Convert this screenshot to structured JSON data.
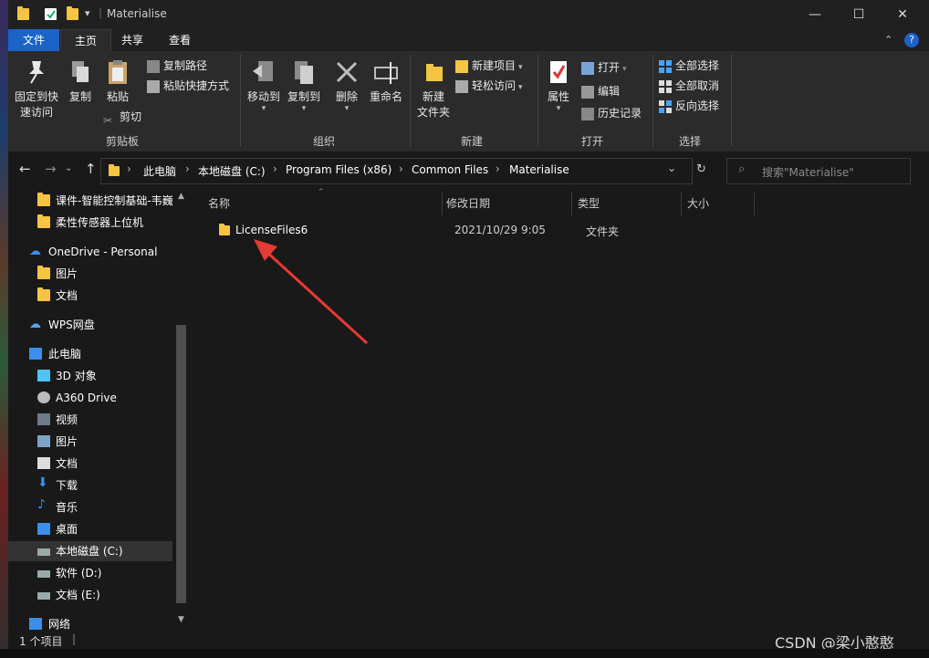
{
  "window": {
    "title": "Materialise",
    "minimize": "—",
    "maximize": "☐",
    "close": "✕"
  },
  "ribbon_tabs": [
    "文件",
    "主页",
    "共享",
    "查看"
  ],
  "ribbon": {
    "clipboard": {
      "pin_label_1": "固定到快",
      "pin_label_2": "速访问",
      "copy": "复制",
      "paste": "粘贴",
      "copy_path": "复制路径",
      "paste_shortcut": "粘贴快捷方式",
      "cut": "剪切",
      "group": "剪贴板"
    },
    "organize": {
      "move_to": "移动到",
      "copy_to": "复制到",
      "delete": "删除",
      "rename": "重命名",
      "group": "组织"
    },
    "new": {
      "new_folder_1": "新建",
      "new_folder_2": "文件夹",
      "new_item": "新建项目",
      "easy_access": "轻松访问",
      "group": "新建"
    },
    "open": {
      "properties": "属性",
      "open": "打开",
      "edit": "编辑",
      "history": "历史记录",
      "group": "打开"
    },
    "select": {
      "select_all": "全部选择",
      "select_none": "全部取消",
      "invert": "反向选择",
      "group": "选择"
    }
  },
  "address": {
    "crumbs": [
      "此电脑",
      "本地磁盘 (C:)",
      "Program Files (x86)",
      "Common Files",
      "Materialise"
    ],
    "search_placeholder": "搜索\"Materialise\""
  },
  "nav_pane": [
    {
      "label": "课件-智能控制基础-韦巍",
      "icon": "folder-icon"
    },
    {
      "label": "柔性传感器上位机",
      "icon": "folder-icon"
    },
    {
      "label": "OneDrive - Personal",
      "icon": "cloud-icon"
    },
    {
      "label": "图片",
      "icon": "folder-icon"
    },
    {
      "label": "文档",
      "icon": "folder-icon"
    },
    {
      "label": "WPS网盘",
      "icon": "cloud-icon"
    },
    {
      "label": "此电脑",
      "icon": "computer-icon"
    },
    {
      "label": "3D 对象",
      "icon": "cube-icon"
    },
    {
      "label": "A360 Drive",
      "icon": "drive-icon"
    },
    {
      "label": "视频",
      "icon": "video-icon"
    },
    {
      "label": "图片",
      "icon": "picture-icon"
    },
    {
      "label": "文档",
      "icon": "document-icon"
    },
    {
      "label": "下载",
      "icon": "download-icon"
    },
    {
      "label": "音乐",
      "icon": "music-icon"
    },
    {
      "label": "桌面",
      "icon": "desktop-icon"
    },
    {
      "label": "本地磁盘 (C:)",
      "icon": "disk-icon"
    },
    {
      "label": "软件 (D:)",
      "icon": "disk-icon"
    },
    {
      "label": "文档 (E:)",
      "icon": "disk-icon"
    },
    {
      "label": "网络",
      "icon": "network-icon"
    }
  ],
  "file_list": {
    "columns": [
      "名称",
      "修改日期",
      "类型",
      "大小"
    ],
    "rows": [
      {
        "name": "LicenseFiles6",
        "date": "2021/10/29 9:05",
        "type": "文件夹",
        "size": ""
      }
    ]
  },
  "status": {
    "count": "1 个项目"
  },
  "watermark": "CSDN @梁小憨憨",
  "colors": {
    "accent": "#1b63c9",
    "folder": "#f5c542",
    "arrow": "#e53935"
  }
}
